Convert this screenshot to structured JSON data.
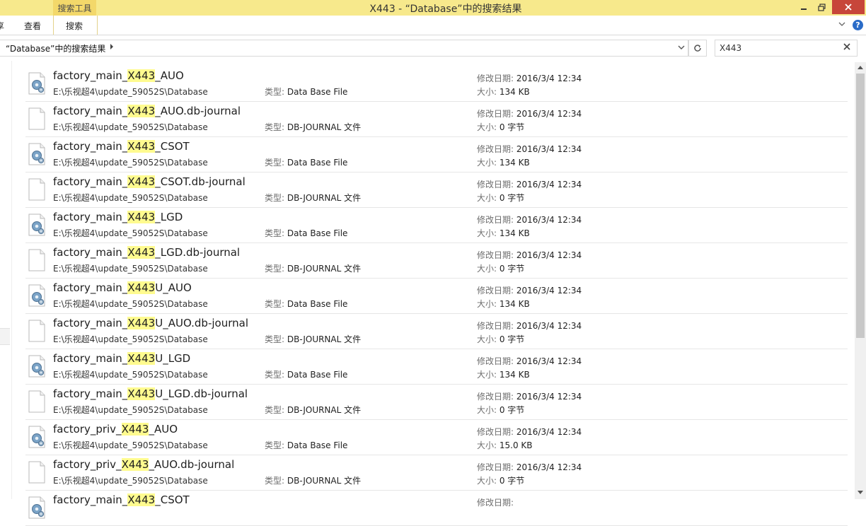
{
  "window": {
    "title": "X443 - “Database”中的搜索结果",
    "search_tools_tab": "搜索工具"
  },
  "ribbon": {
    "tabs": [
      "享",
      "查看",
      "搜索"
    ]
  },
  "address": {
    "path": "“Database”中的搜索结果"
  },
  "search": {
    "value": "X443",
    "placeholder": ""
  },
  "labels": {
    "type": "类型: ",
    "modified": "修改日期: ",
    "size": "大小: "
  },
  "results": [
    {
      "icon": "database-file-icon",
      "pre": "factory_main_",
      "hl": "X443",
      "post": "_AUO",
      "path": "E:\\乐视超4\\update_59052S\\Database",
      "type": "Data Base File",
      "modified": "2016/3/4 12:34",
      "size": "134 KB"
    },
    {
      "icon": "blank-file-icon",
      "pre": "factory_main_",
      "hl": "X443",
      "post": "_AUO.db-journal",
      "path": "E:\\乐视超4\\update_59052S\\Database",
      "type": "DB-JOURNAL 文件",
      "modified": "2016/3/4 12:34",
      "size": "0 字节"
    },
    {
      "icon": "database-file-icon",
      "pre": "factory_main_",
      "hl": "X443",
      "post": "_CSOT",
      "path": "E:\\乐视超4\\update_59052S\\Database",
      "type": "Data Base File",
      "modified": "2016/3/4 12:34",
      "size": "134 KB"
    },
    {
      "icon": "blank-file-icon",
      "pre": "factory_main_",
      "hl": "X443",
      "post": "_CSOT.db-journal",
      "path": "E:\\乐视超4\\update_59052S\\Database",
      "type": "DB-JOURNAL 文件",
      "modified": "2016/3/4 12:34",
      "size": "0 字节"
    },
    {
      "icon": "database-file-icon",
      "pre": "factory_main_",
      "hl": "X443",
      "post": "_LGD",
      "path": "E:\\乐视超4\\update_59052S\\Database",
      "type": "Data Base File",
      "modified": "2016/3/4 12:34",
      "size": "134 KB"
    },
    {
      "icon": "blank-file-icon",
      "pre": "factory_main_",
      "hl": "X443",
      "post": "_LGD.db-journal",
      "path": "E:\\乐视超4\\update_59052S\\Database",
      "type": "DB-JOURNAL 文件",
      "modified": "2016/3/4 12:34",
      "size": "0 字节"
    },
    {
      "icon": "database-file-icon",
      "pre": "factory_main_",
      "hl": "X443",
      "post": "U_AUO",
      "path": "E:\\乐视超4\\update_59052S\\Database",
      "type": "Data Base File",
      "modified": "2016/3/4 12:34",
      "size": "134 KB"
    },
    {
      "icon": "blank-file-icon",
      "pre": "factory_main_",
      "hl": "X443",
      "post": "U_AUO.db-journal",
      "path": "E:\\乐视超4\\update_59052S\\Database",
      "type": "DB-JOURNAL 文件",
      "modified": "2016/3/4 12:34",
      "size": "0 字节"
    },
    {
      "icon": "database-file-icon",
      "pre": "factory_main_",
      "hl": "X443",
      "post": "U_LGD",
      "path": "E:\\乐视超4\\update_59052S\\Database",
      "type": "Data Base File",
      "modified": "2016/3/4 12:34",
      "size": "134 KB"
    },
    {
      "icon": "blank-file-icon",
      "pre": "factory_main_",
      "hl": "X443",
      "post": "U_LGD.db-journal",
      "path": "E:\\乐视超4\\update_59052S\\Database",
      "type": "DB-JOURNAL 文件",
      "modified": "2016/3/4 12:34",
      "size": "0 字节"
    },
    {
      "icon": "database-file-icon",
      "pre": "factory_priv_",
      "hl": "X443",
      "post": "_AUO",
      "path": "E:\\乐视超4\\update_59052S\\Database",
      "type": "Data Base File",
      "modified": "2016/3/4 12:34",
      "size": "15.0 KB"
    },
    {
      "icon": "blank-file-icon",
      "pre": "factory_priv_",
      "hl": "X443",
      "post": "_AUO.db-journal",
      "path": "E:\\乐视超4\\update_59052S\\Database",
      "type": "DB-JOURNAL 文件",
      "modified": "2016/3/4 12:34",
      "size": "0 字节"
    },
    {
      "icon": "database-file-icon",
      "pre": "factory_main_",
      "hl": "X443",
      "post": "_CSOT",
      "path": "",
      "type": "",
      "modified": "",
      "size": ""
    }
  ]
}
